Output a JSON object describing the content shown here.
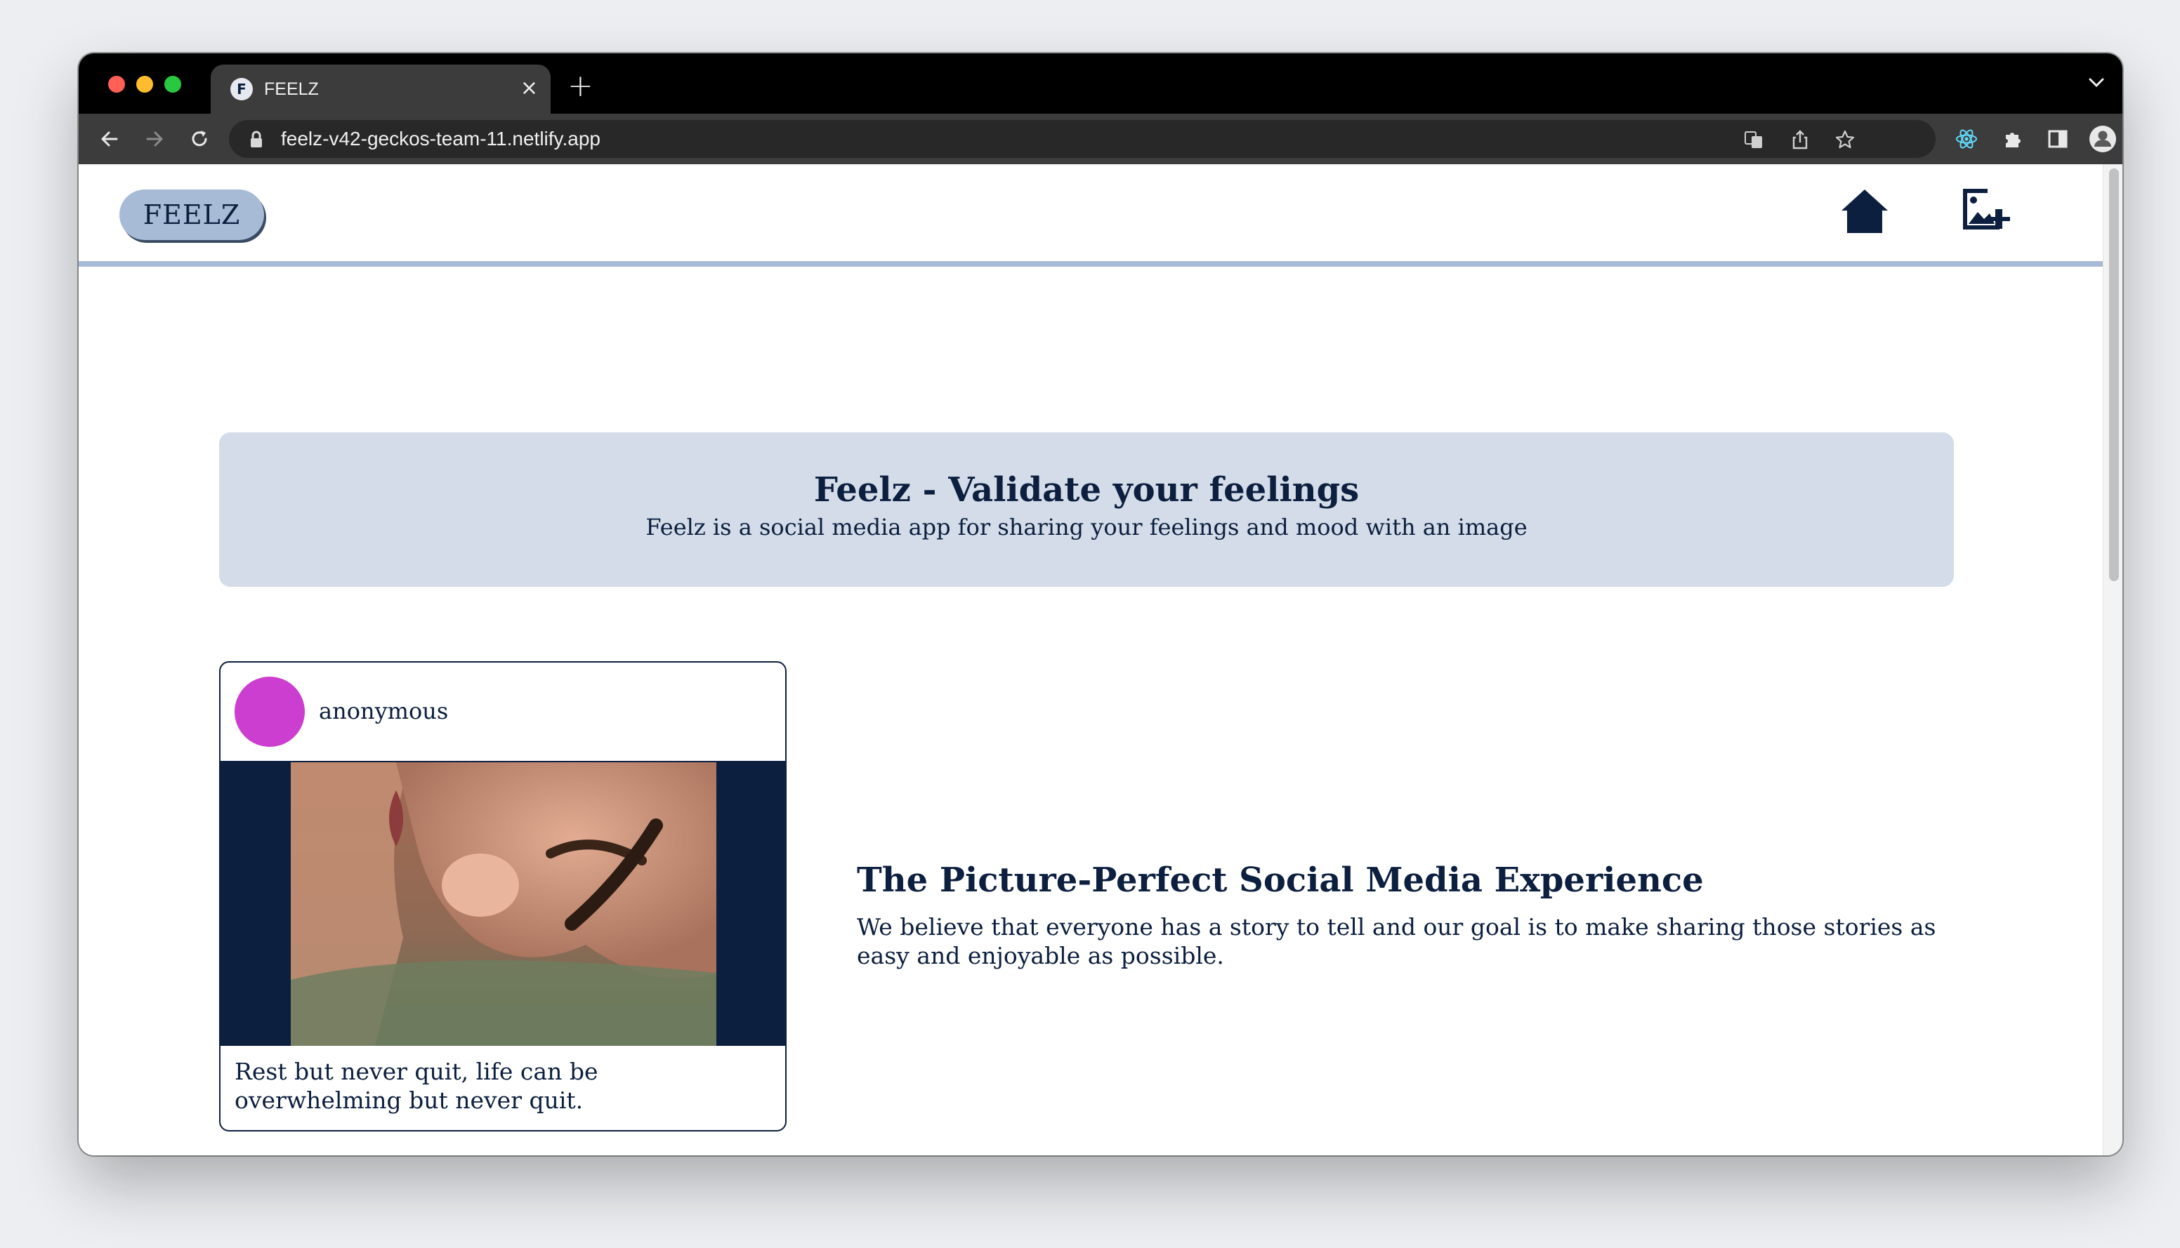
{
  "browser": {
    "tab_title": "FEELZ",
    "favicon_letter": "F",
    "tab_close": "×",
    "new_tab": "+",
    "url": "feelz-v42-geckos-team-11.netlify.app"
  },
  "site": {
    "logo_text": "FEELZ",
    "accent_color": "#a7bbd6",
    "text_color": "#0c1f3f"
  },
  "hero": {
    "title": "Feelz - Validate your feelings",
    "subtitle": "Feelz is a social media app for sharing your feelings and mood with an image"
  },
  "post": {
    "username": "anonymous",
    "avatar_color": "#cc3ecf",
    "caption": "Rest but never quit, life can be overwhelming but never quit."
  },
  "feature": {
    "title": "The Picture-Perfect Social Media Experience",
    "body": "We believe that everyone has a story to tell and our goal is to make sharing those stories as easy and enjoyable as possible."
  }
}
